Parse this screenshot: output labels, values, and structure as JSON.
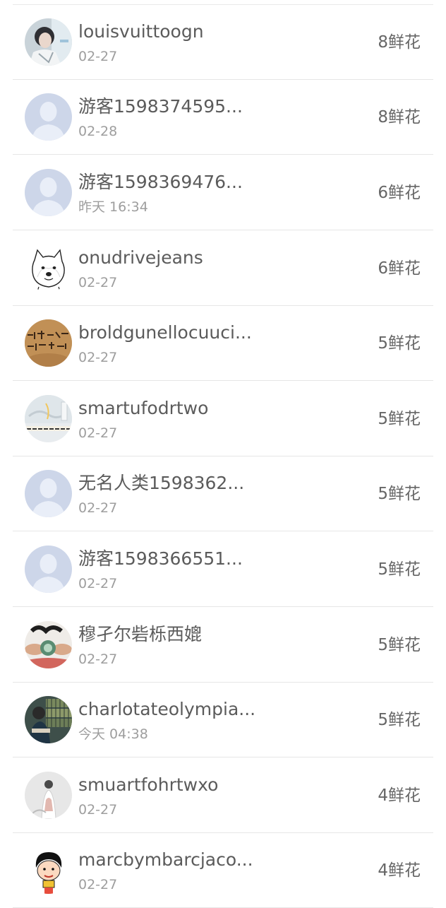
{
  "rows": [
    {
      "name": "louisvuittoogn",
      "date": "02-27",
      "flowers": "8鲜花",
      "avatar": "photo-avatar-girl-icon"
    },
    {
      "name": "游客1598374595...",
      "date": "02-28",
      "flowers": "8鲜花",
      "avatar": "default-avatar-icon"
    },
    {
      "name": "游客1598369476...",
      "date": "昨天 16:34",
      "flowers": "6鲜花",
      "avatar": "default-avatar-icon"
    },
    {
      "name": "onudrivejeans",
      "date": "02-27",
      "flowers": "6鲜花",
      "avatar": "doge-avatar-icon"
    },
    {
      "name": "broldgunellocuuci...",
      "date": "02-27",
      "flowers": "5鲜花",
      "avatar": "calligraphy-avatar-icon"
    },
    {
      "name": "smartufodrtwo",
      "date": "02-27",
      "flowers": "5鲜花",
      "avatar": "photo-avatar-light-icon"
    },
    {
      "name": "无名人类1598362...",
      "date": "02-27",
      "flowers": "5鲜花",
      "avatar": "default-avatar-icon"
    },
    {
      "name": "游客1598366551...",
      "date": "02-27",
      "flowers": "5鲜花",
      "avatar": "default-avatar-icon"
    },
    {
      "name": "穆孑尔砦栎西媲",
      "date": "02-27",
      "flowers": "5鲜花",
      "avatar": "photo-avatar-hands-icon"
    },
    {
      "name": "charlotateolympia...",
      "date": "今天 04:38",
      "flowers": "5鲜花",
      "avatar": "photo-avatar-bookshelf-icon"
    },
    {
      "name": "smuartfohrtwxo",
      "date": "02-27",
      "flowers": "4鲜花",
      "avatar": "photo-avatar-figure-icon"
    },
    {
      "name": "marcbymbarcjaco...",
      "date": "02-27",
      "flowers": "4鲜花",
      "avatar": "cartoon-avatar-icon"
    }
  ]
}
